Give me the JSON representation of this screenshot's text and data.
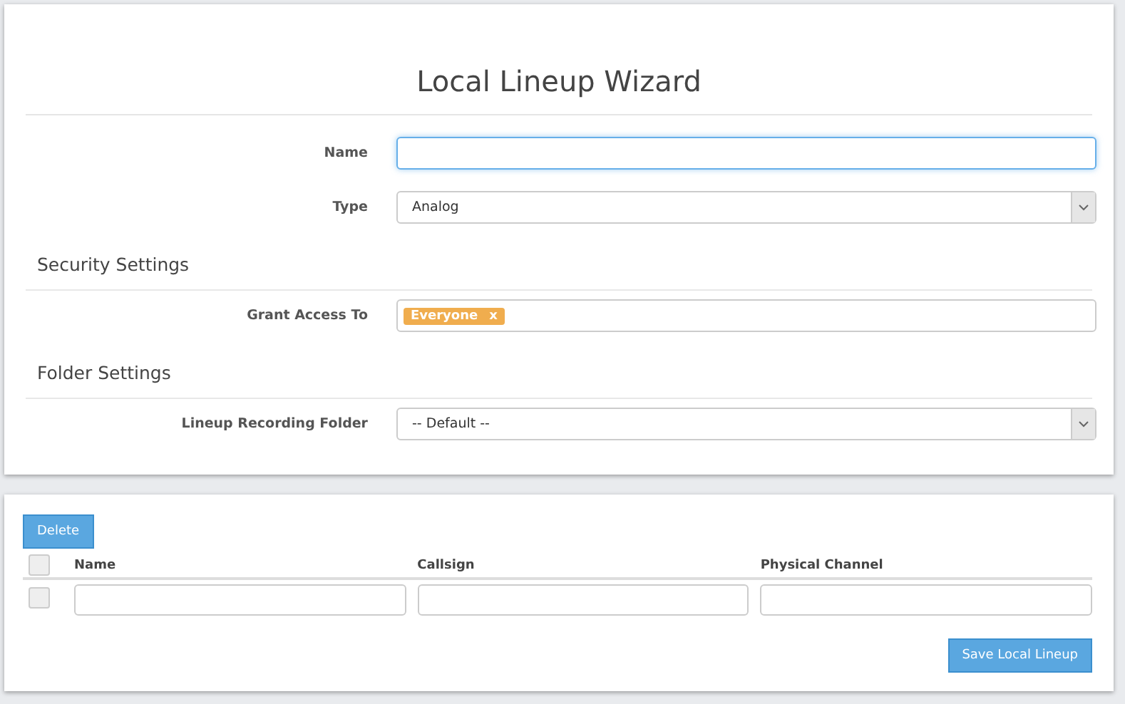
{
  "title": "Local Lineup Wizard",
  "fields": [
    {
      "kind": "text",
      "label": "Name",
      "focused": true
    },
    {
      "kind": "select",
      "label": "Type",
      "value": "Analog"
    }
  ],
  "sections": [
    {
      "heading": "Security Settings",
      "fields": [
        {
          "kind": "tags",
          "label": "Grant Access To",
          "tags": [
            {
              "label": "Everyone",
              "remove": "x"
            }
          ]
        }
      ]
    },
    {
      "heading": "Folder Settings",
      "fields": [
        {
          "kind": "select",
          "label": "Lineup Recording Folder",
          "value": "-- Default --"
        }
      ]
    }
  ],
  "table": {
    "delete_button": "Delete",
    "select_all": {
      "checked": false
    },
    "columns": [
      "Name",
      "Callsign",
      "Physical Channel"
    ],
    "rows": [
      {
        "checked": false
      }
    ]
  },
  "save_button": "Save Local Lineup"
}
